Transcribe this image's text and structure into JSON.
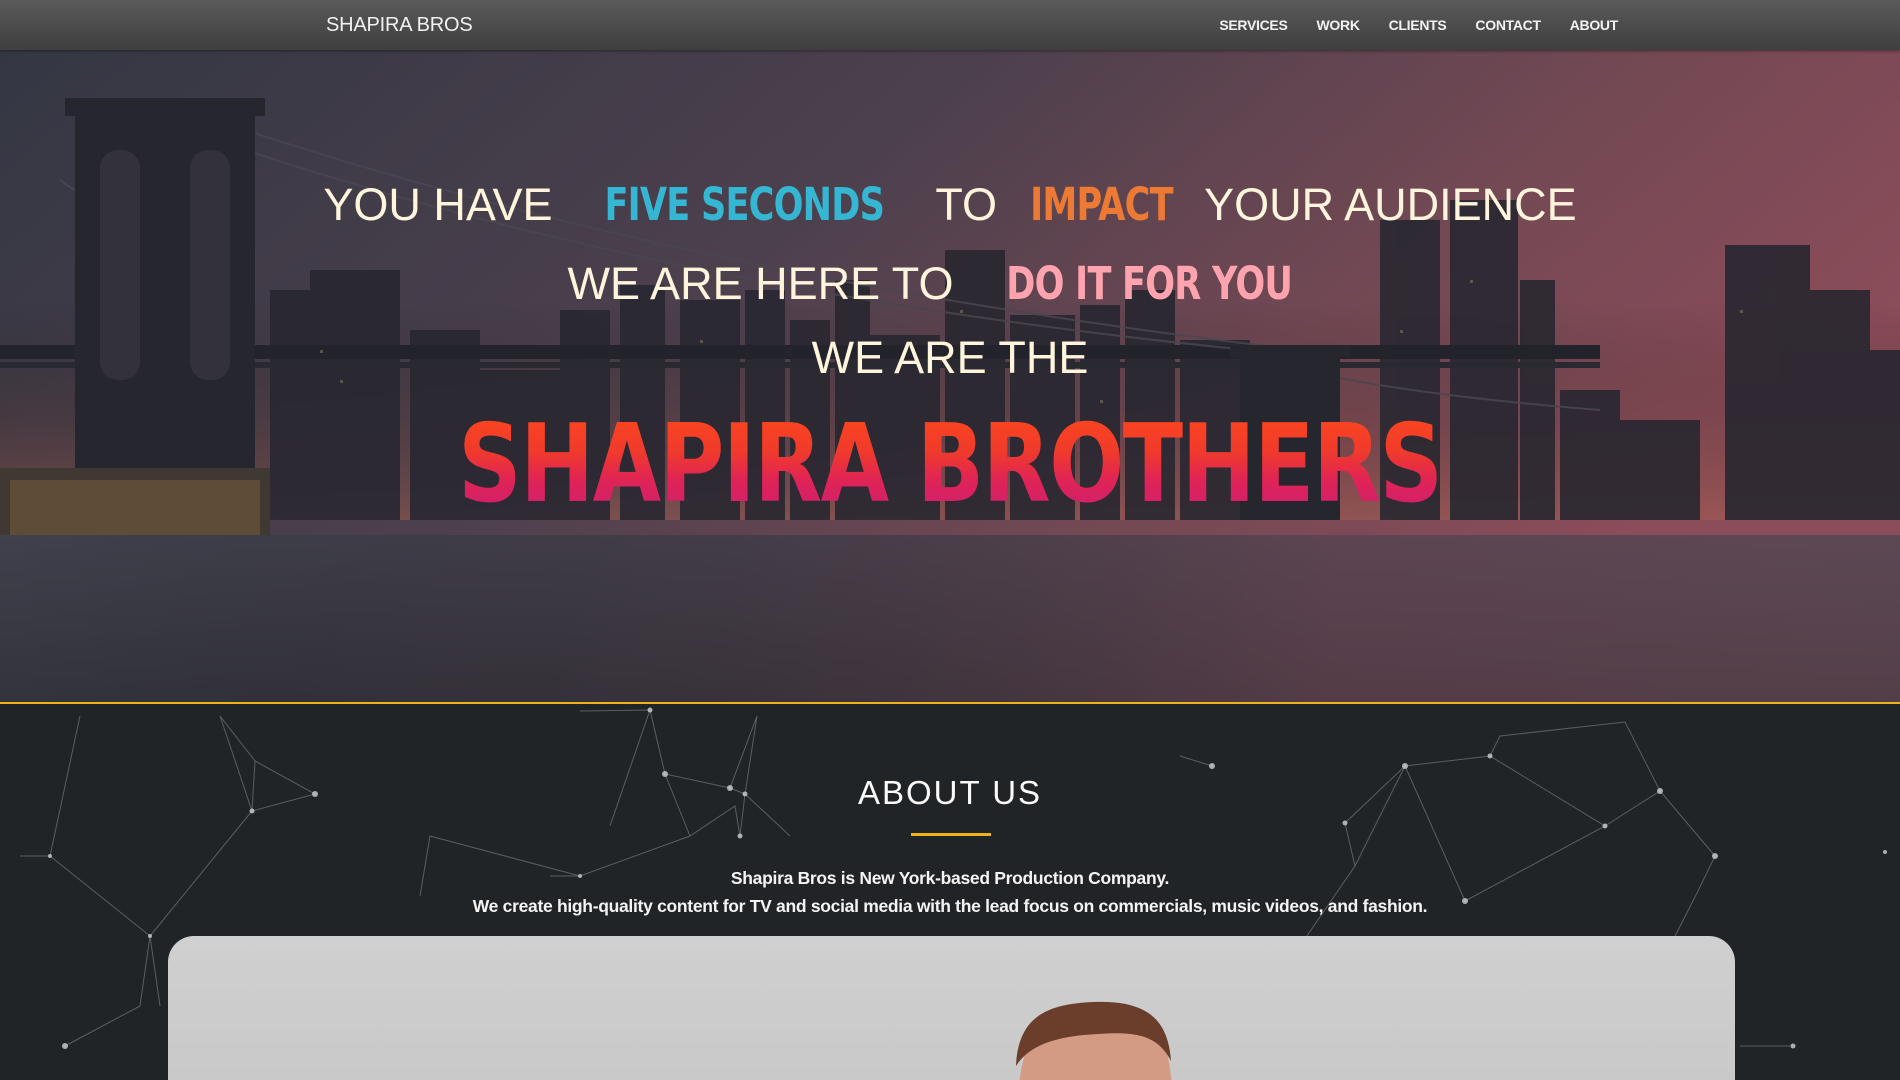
{
  "nav": {
    "brand": "SHAPIRA BROS",
    "links": [
      "SERVICES",
      "WORK",
      "CLIENTS",
      "CONTACT",
      "ABOUT"
    ]
  },
  "hero": {
    "line1": {
      "a": "YOU HAVE ",
      "b": "FIVE SECONDS",
      "c": " TO ",
      "d": "IMPACT",
      "e": " YOUR AUDIENCE"
    },
    "line2": {
      "a": "WE ARE HERE TO ",
      "b": "DO IT FOR YOU"
    },
    "line3": "WE ARE THE",
    "headline": "SHAPIRA BROTHERS"
  },
  "about": {
    "title": "ABOUT US",
    "desc_line1": "Shapira Bros is New York-based Production Company.",
    "desc_line2": "We create high-quality content for TV and social media with the lead focus on commercials, music videos, and fashion."
  },
  "colors": {
    "accent": "#f0b21b",
    "blue": "#35b6d2",
    "orange": "#ec7a35",
    "pink": "#ffa3ae",
    "dark_bg": "#212427"
  },
  "icons": []
}
